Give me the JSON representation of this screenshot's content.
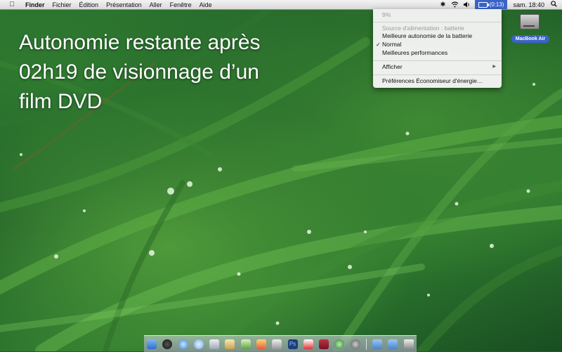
{
  "menubar": {
    "apple_icon": "apple-icon",
    "app_name": "Finder",
    "menus": [
      "Fichier",
      "Édition",
      "Présentation",
      "Aller",
      "Fenêtre",
      "Aide"
    ],
    "status_icons": [
      "bluetooth-icon",
      "wifi-icon",
      "volume-icon"
    ],
    "battery_time": "(0:13)",
    "clock": "sam. 18:40",
    "spotlight_icon": "spotlight-search-icon"
  },
  "battery_menu": {
    "percent": "9%",
    "power_source": "Source d'alimentation : batterie",
    "options": [
      {
        "label": "Meilleure autonomie de la batterie",
        "checked": false
      },
      {
        "label": "Normal",
        "checked": true
      },
      {
        "label": "Meilleures performances",
        "checked": false
      }
    ],
    "show_label": "Afficher",
    "preferences_label": "Préférences Économiseur d'énergie…"
  },
  "desktop": {
    "disk_label": "MacBook Air"
  },
  "caption": {
    "line1": "Autonomie restante après",
    "line2": "02h19 de visionnage d’un",
    "line3": "film DVD"
  },
  "dock": {
    "icons": [
      "finder-icon",
      "dashboard-icon",
      "safari-icon",
      "ichat-icon",
      "mail-icon",
      "preview-icon",
      "itunes-icon",
      "iphoto-icon",
      "ical-icon",
      "photoshop-icon",
      "calendar-icon",
      "photo-booth-icon",
      "time-machine-icon",
      "system-preferences-icon",
      "applications-folder-icon",
      "documents-folder-icon",
      "trash-icon"
    ]
  }
}
